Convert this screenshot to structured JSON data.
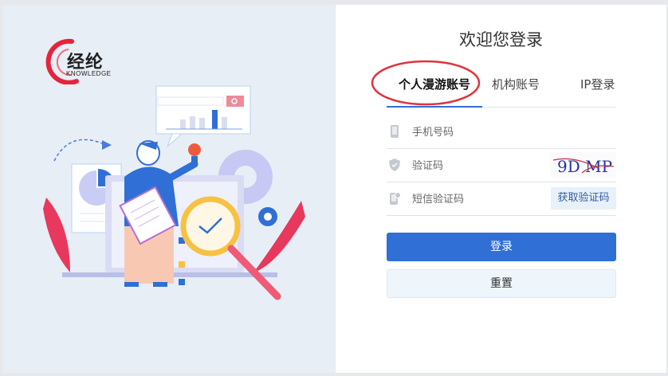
{
  "brand": {
    "name": "经纶",
    "subtitle": "KNOWLEDGE",
    "accent": "#e6233c"
  },
  "login": {
    "title": "欢迎您登录",
    "tabs": [
      {
        "label": "个人漫游账号",
        "active": true
      },
      {
        "label": "机构账号",
        "active": false
      },
      {
        "label": "IP登录",
        "active": false
      }
    ],
    "phone": {
      "placeholder": "手机号码",
      "icon": "phone-icon"
    },
    "captcha": {
      "placeholder": "验证码",
      "icon": "shield-icon",
      "image_text": "9D MP"
    },
    "sms": {
      "placeholder": "短信验证码",
      "icon": "sms-phone-icon",
      "button_label": "获取验证码"
    },
    "submit_label": "登录",
    "reset_label": "重置"
  },
  "colors": {
    "primary": "#2f6fd6",
    "annotation": "#e0333c"
  }
}
